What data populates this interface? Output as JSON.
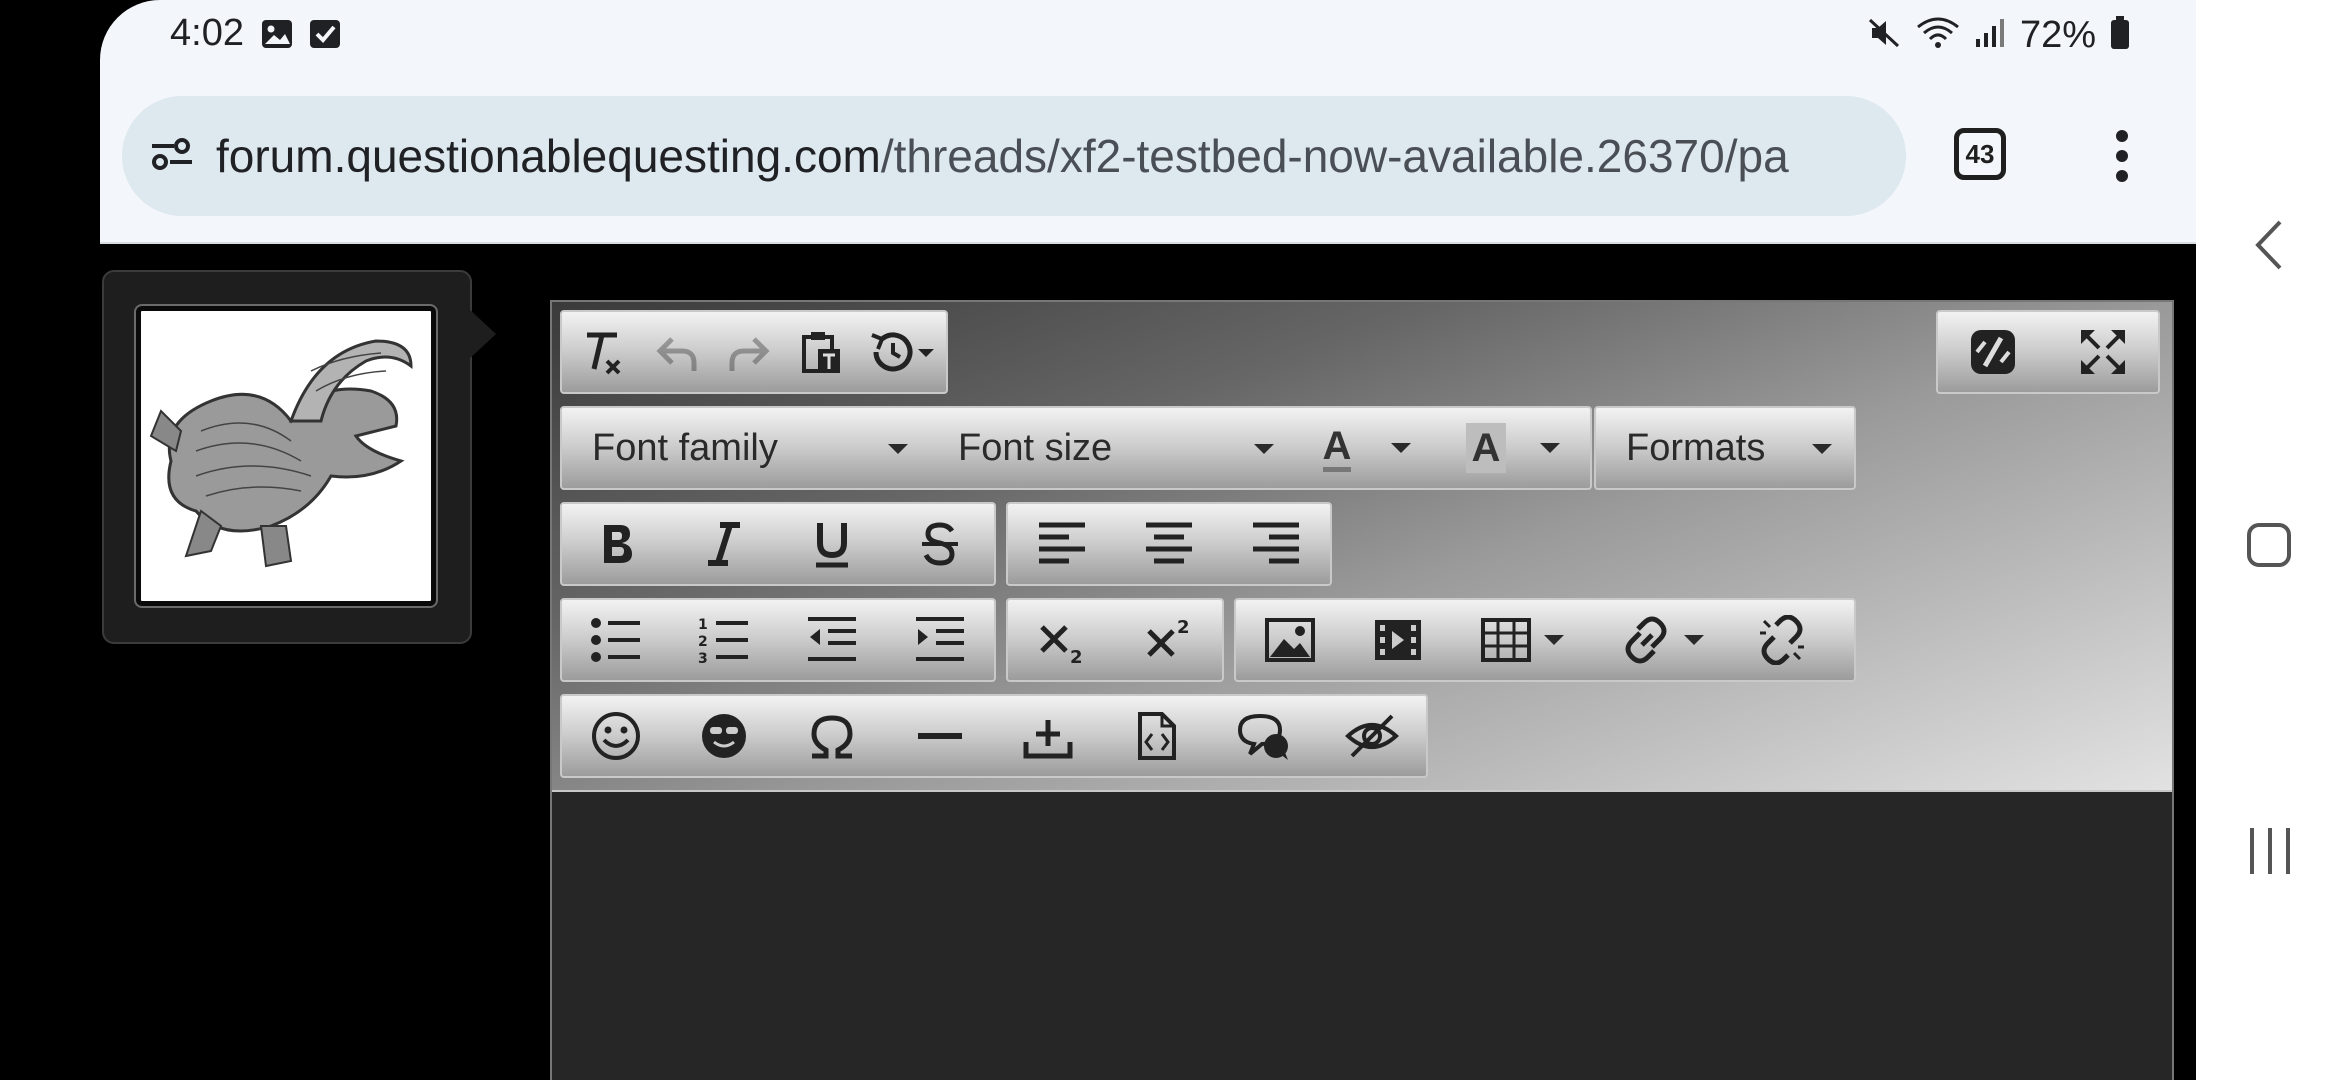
{
  "status_bar": {
    "time": "4:02",
    "battery": "72%",
    "icons_left": [
      "image-icon",
      "checkbox-icon"
    ],
    "icons_right": [
      "mute-icon",
      "wifi-icon",
      "signal-icon",
      "battery-icon"
    ]
  },
  "browser": {
    "url_domain": "forum.questionablequesting.com",
    "url_path": "/threads/xf2-testbed-now-available.26370/pa",
    "tab_count": "43"
  },
  "editor": {
    "toolbar": {
      "font_family_label": "Font family",
      "font_size_label": "Font size",
      "formats_label": "Formats",
      "text_color_letter": "A",
      "bg_color_letter": "A"
    }
  },
  "colors": {
    "page_bg": "#000000",
    "chrome_bg": "#f3f6fb",
    "url_bar_bg": "#dde9ef",
    "editor_content_bg": "#262626"
  }
}
